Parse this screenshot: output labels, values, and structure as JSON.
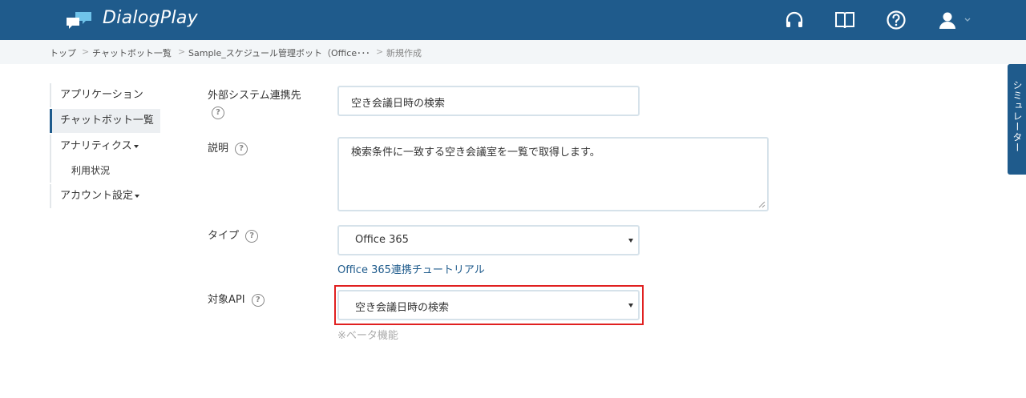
{
  "header": {
    "brand": "DialogPlay",
    "icons": [
      "headset-icon",
      "book-icon",
      "help-icon",
      "user-icon"
    ]
  },
  "breadcrumb": {
    "items": [
      "トップ",
      "チャットボット一覧",
      "Sample_スケジュール管理ボット（Office･･･",
      "新規作成"
    ],
    "separator": ">"
  },
  "sidebar": {
    "items": [
      {
        "label": "アプリケーション"
      },
      {
        "label": "チャットボット一覧"
      },
      {
        "label": "アナリティクス"
      },
      {
        "label": "利用状況"
      },
      {
        "label": "アカウント設定"
      }
    ]
  },
  "form": {
    "external_system": {
      "label": "外部システム連携先",
      "value": "空き会議日時の検索"
    },
    "description": {
      "label": "説明",
      "value": "検索条件に一致する空き会議室を一覧で取得します。"
    },
    "type": {
      "label": "タイプ",
      "value": "Office 365",
      "tutorial_link": "Office 365連携チュートリアル"
    },
    "target_api": {
      "label": "対象API",
      "value": "空き会議日時の検索",
      "note": "※ベータ機能"
    },
    "help_glyph": "?"
  },
  "simulator": {
    "label": "シミュレーター"
  },
  "colors": {
    "primary": "#1f5b8c",
    "breadcrumb_bg": "#f3f6f8",
    "highlight": "#e02020",
    "input_border": "#d6e2ea"
  }
}
